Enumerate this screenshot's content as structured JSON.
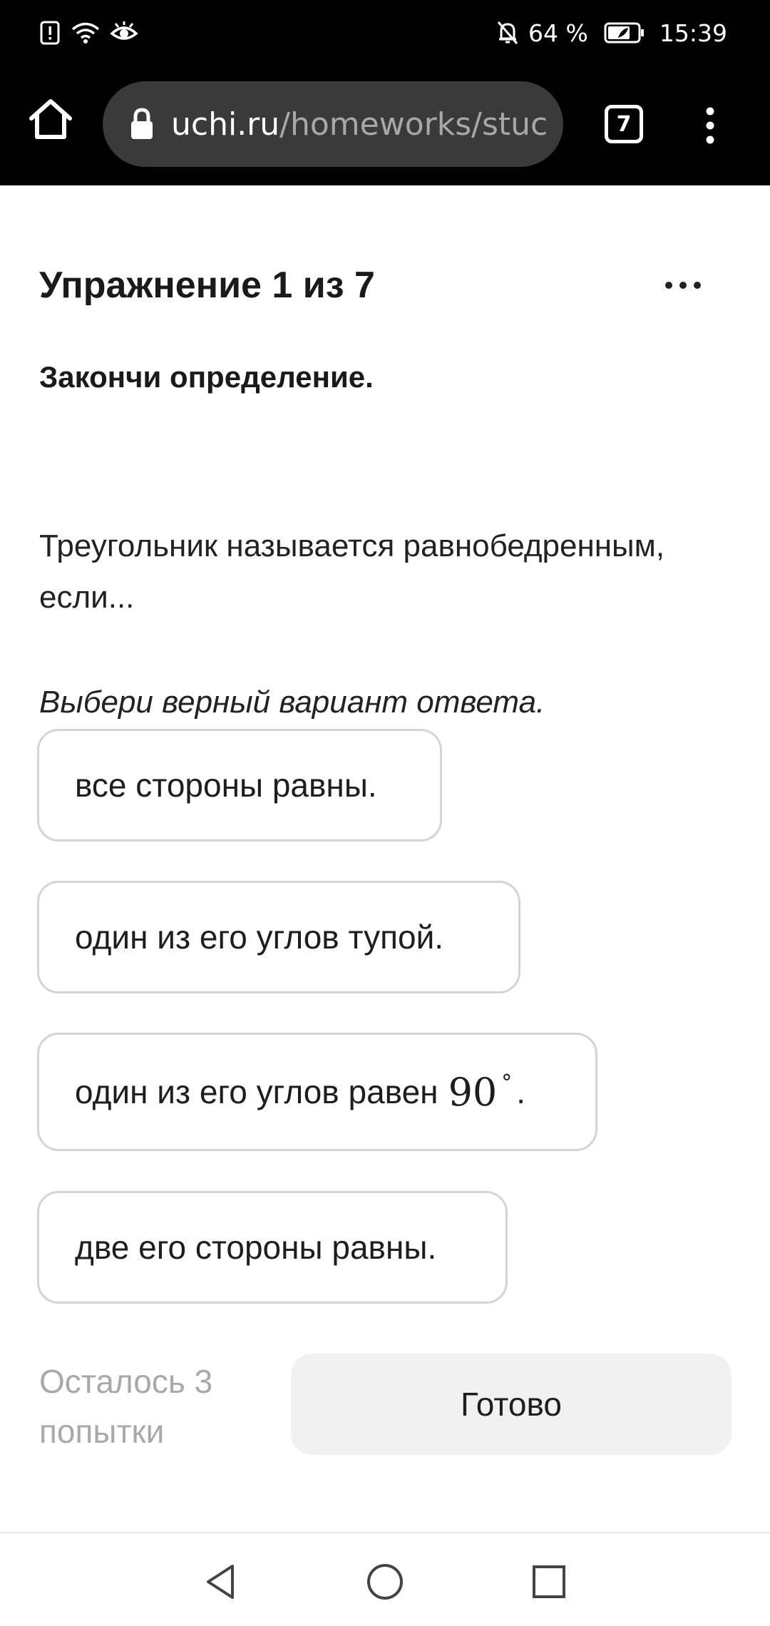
{
  "status_bar": {
    "battery_percent": "64 %",
    "time": "15:39",
    "icons": [
      "alert-icon",
      "wifi-icon",
      "eye-icon",
      "mute-icon",
      "battery-icon"
    ]
  },
  "browser": {
    "url_host": "uchi.ru",
    "url_path": "/homeworks/stuc",
    "tab_count": "7",
    "icons": [
      "home-icon",
      "lock-icon",
      "tabs-icon",
      "overflow-menu-icon"
    ]
  },
  "exercise": {
    "title": "Упражнение 1 из 7",
    "task_heading": "Закончи определение.",
    "question": "Треугольник называется равнобедренным, если...",
    "hint": "Выбери верный вариант ответа."
  },
  "options": [
    {
      "label": "все стороны равны."
    },
    {
      "label": "один из его углов тупой."
    },
    {
      "label": "один из его углов равен",
      "math": "90",
      "suffix": "."
    },
    {
      "label": "две его стороны равны."
    }
  ],
  "footer": {
    "attempts": "Осталось 3 попытки",
    "done_label": "Готово"
  },
  "nav_bar": {
    "icons": [
      "back-icon",
      "home-circle-icon",
      "recents-icon"
    ]
  },
  "colors": {
    "bar_background": "#000000",
    "url_pill": "#3a3a3a",
    "option_border": "#d4d4d4",
    "done_button": "#f1f1f1",
    "attempts_text": "#a9a9a9"
  }
}
